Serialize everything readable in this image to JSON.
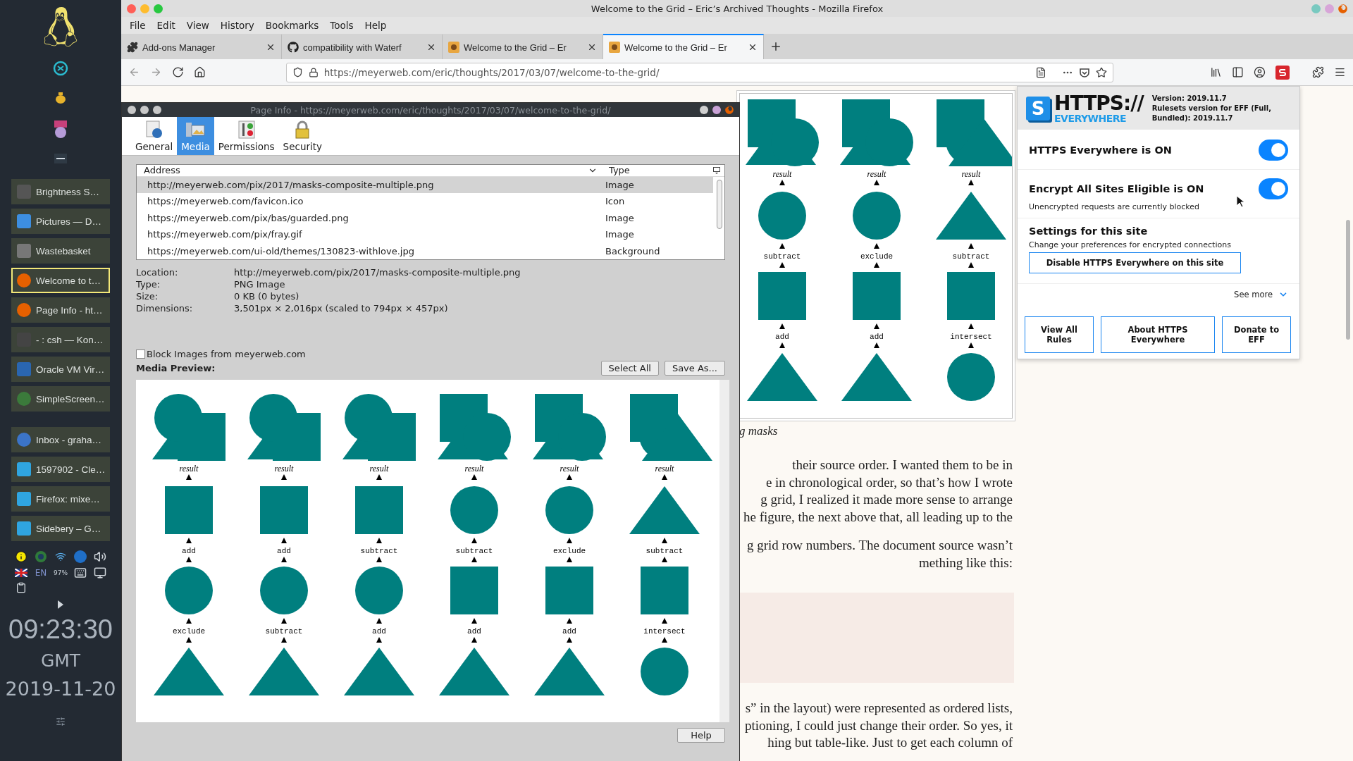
{
  "desktop_panel": {
    "tasks": [
      {
        "label": "Brightness S…",
        "selected": false
      },
      {
        "label": "Pictures — D…",
        "selected": false
      },
      {
        "label": "Wastebasket",
        "selected": false
      },
      {
        "label": "Welcome to t…",
        "selected": true
      },
      {
        "label": "Page Info - ht…",
        "selected": false
      },
      {
        "label": "- : csh — Kon…",
        "selected": false
      },
      {
        "label": "Oracle VM Vir…",
        "selected": false
      },
      {
        "label": "SimpleScreen…",
        "selected": false
      }
    ],
    "tasks_2": [
      {
        "label": "Inbox - graha…",
        "selected": false
      },
      {
        "label": "1597902 - Cle…",
        "selected": false
      },
      {
        "label": "Firefox: mixe…",
        "selected": false
      },
      {
        "label": "Sidebery – G…",
        "selected": false
      }
    ],
    "tray": {
      "language": "EN",
      "battery": "97%"
    },
    "clock": {
      "time": "09:23:30",
      "zone": "GMT",
      "date": "2019-11-20"
    }
  },
  "browser": {
    "window_title": "Welcome to the Grid – Eric’s Archived Thoughts - Mozilla Firefox",
    "menu": [
      "File",
      "Edit",
      "View",
      "History",
      "Bookmarks",
      "Tools",
      "Help"
    ],
    "tabs": [
      {
        "label": "Add-ons Manager",
        "kind": "addons",
        "selected": false
      },
      {
        "label": "compatibility with Waterf",
        "kind": "github",
        "selected": false
      },
      {
        "label": "Welcome to the Grid – Er",
        "kind": "site",
        "selected": false
      },
      {
        "label": "Welcome to the Grid – Er",
        "kind": "site",
        "selected": true
      }
    ],
    "url": "https://meyerweb.com/eric/thoughts/2017/03/07/welcome-to-the-grid/"
  },
  "page": {
    "figure": {
      "columns": [
        {
          "result": "result",
          "shapes": [
            {
              "kind": "circle"
            },
            {
              "kind": "square"
            },
            {
              "kind": "triangle"
            }
          ],
          "ops": [
            "subtract",
            "add"
          ]
        },
        {
          "result": "result",
          "shapes": [
            {
              "kind": "circle"
            },
            {
              "kind": "square"
            },
            {
              "kind": "triangle"
            }
          ],
          "ops": [
            "exclude",
            "add"
          ]
        },
        {
          "result": "result",
          "shapes": [
            {
              "kind": "triangle"
            },
            {
              "kind": "square"
            },
            {
              "kind": "circle"
            }
          ],
          "ops": [
            "subtract",
            "intersect"
          ]
        }
      ]
    },
    "caption": "g masks",
    "paragraphs": [
      [
        "their source order.  I wanted them to be in",
        "e in chronological order, so that’s how I wrote",
        "g grid, I realized it made more sense to arrange",
        "he figure, the next above that, all leading up to the"
      ],
      [
        "g grid row numbers.  The document source wasn’t",
        "mething like this:"
      ],
      [
        "s” in the layout) were represented as ordered lists,",
        "ptioning, I could just change their order.  So yes, it",
        "hing but table-like.  Just to get each column of"
      ]
    ]
  },
  "page_info": {
    "title": "Page Info - https://meyerweb.com/eric/thoughts/2017/03/07/welcome-to-the-grid/",
    "tabs": [
      {
        "label": "General",
        "kind": "general",
        "selected": false
      },
      {
        "label": "Media",
        "kind": "media",
        "selected": true
      },
      {
        "label": "Permissions",
        "kind": "permissions",
        "selected": false
      },
      {
        "label": "Security",
        "kind": "security",
        "selected": false
      }
    ],
    "columns": [
      "Address",
      "Type"
    ],
    "rows": [
      {
        "address": "http://meyerweb.com/pix/2017/masks-composite-multiple.png",
        "type": "Image",
        "selected": true
      },
      {
        "address": "https://meyerweb.com/favicon.ico",
        "type": "Icon",
        "selected": false
      },
      {
        "address": "https://meyerweb.com/pix/bas/guarded.png",
        "type": "Image",
        "selected": false
      },
      {
        "address": "https://meyerweb.com/pix/fray.gif",
        "type": "Image",
        "selected": false
      },
      {
        "address": "https://meyerweb.com/ui-old/themes/130823-withlove.jpg",
        "type": "Background",
        "selected": false
      }
    ],
    "details": [
      {
        "label": "Location:",
        "value": "http://meyerweb.com/pix/2017/masks-composite-multiple.png"
      },
      {
        "label": "Type:",
        "value": "PNG Image"
      },
      {
        "label": "Size:",
        "value": "0 KB (0 bytes)"
      },
      {
        "label": "Dimensions:",
        "value": "3,501px × 2,016px (scaled to 794px × 457px)"
      }
    ],
    "block_images": {
      "label": "Block Images from meyerweb.com",
      "checked": false
    },
    "preview_label": "Media Preview:",
    "buttons": [
      "Select All",
      "Save As..."
    ],
    "preview_columns": [
      {
        "result": "result",
        "shapes": [
          {
            "kind": "square"
          },
          {
            "kind": "circle"
          },
          {
            "kind": "triangle"
          }
        ],
        "ops": [
          "add",
          "exclude"
        ]
      },
      {
        "result": "result",
        "shapes": [
          {
            "kind": "square"
          },
          {
            "kind": "circle"
          },
          {
            "kind": "triangle"
          }
        ],
        "ops": [
          "add",
          "subtract"
        ]
      },
      {
        "result": "result",
        "shapes": [
          {
            "kind": "square"
          },
          {
            "kind": "circle"
          },
          {
            "kind": "triangle"
          }
        ],
        "ops": [
          "subtract",
          "add"
        ]
      },
      {
        "result": "result",
        "shapes": [
          {
            "kind": "circle"
          },
          {
            "kind": "square"
          },
          {
            "kind": "triangle"
          }
        ],
        "ops": [
          "subtract",
          "add"
        ]
      },
      {
        "result": "result",
        "shapes": [
          {
            "kind": "circle"
          },
          {
            "kind": "square"
          },
          {
            "kind": "triangle"
          }
        ],
        "ops": [
          "exclude",
          "add"
        ]
      },
      {
        "result": "result",
        "shapes": [
          {
            "kind": "triangle"
          },
          {
            "kind": "square"
          },
          {
            "kind": "circle"
          }
        ],
        "ops": [
          "subtract",
          "intersect"
        ]
      }
    ],
    "help": "Help"
  },
  "https_everywhere": {
    "logo_letter": "S",
    "logo_title": "HTTPS://",
    "logo_subtitle": "EVERYWHERE",
    "version": "Version: 2019.11.7",
    "rulesets": "Rulesets version for EFF (Full, Bundled): 2019.11.7",
    "toggles": [
      {
        "label": "HTTPS Everywhere is ON",
        "on": true
      },
      {
        "label": "Encrypt All Sites Eligible is ON",
        "note": "Unencrypted requests are currently blocked",
        "on": true
      }
    ],
    "site_title": "Settings for this site",
    "site_note": "Change your preferences for encrypted connections",
    "disable": "Disable HTTPS Everywhere on this site",
    "see_more": "See more",
    "buttons": [
      "View All Rules",
      "About HTTPS Everywhere",
      "Donate to EFF"
    ]
  }
}
